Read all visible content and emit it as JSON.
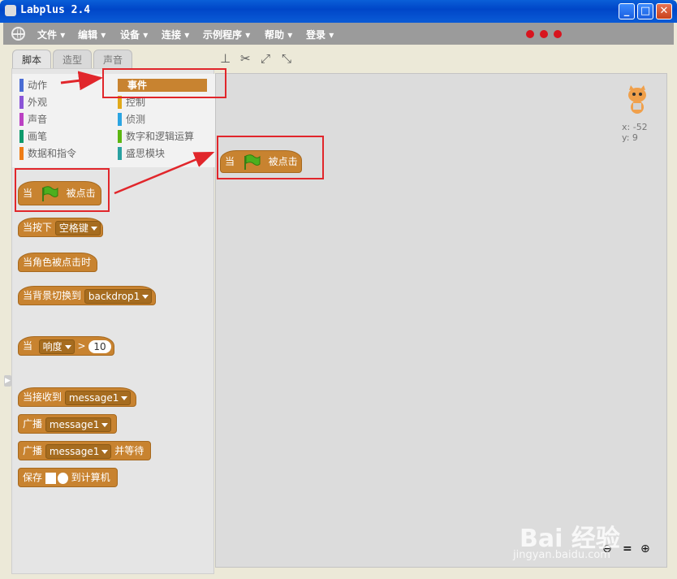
{
  "window": {
    "title": "Labplus 2.4",
    "controls": {
      "minimize": "_",
      "maximize": "□",
      "close": "✕"
    }
  },
  "menubar": {
    "items": [
      "文件",
      "编辑",
      "设备",
      "连接",
      "示例程序",
      "帮助",
      "登录"
    ],
    "status_dots_color": "#d8141e"
  },
  "tabs": [
    "脚本",
    "造型",
    "声音"
  ],
  "tools": [
    "stamp-icon",
    "cut-icon",
    "grow-icon",
    "shrink-icon"
  ],
  "categories": {
    "left": [
      {
        "label": "动作",
        "color": "#4a6cd4"
      },
      {
        "label": "外观",
        "color": "#8a55d7"
      },
      {
        "label": "声音",
        "color": "#bb42c3"
      },
      {
        "label": "画笔",
        "color": "#0e9a6c"
      },
      {
        "label": "数据和指令",
        "color": "#ee7d16"
      }
    ],
    "right": [
      {
        "label": "事件",
        "color": "#c88330"
      },
      {
        "label": "控制",
        "color": "#e1a91a"
      },
      {
        "label": "侦测",
        "color": "#2ca5e2"
      },
      {
        "label": "数字和逻辑运算",
        "color": "#5cb712"
      },
      {
        "label": "盛思模块",
        "color": "#2aa1a1"
      }
    ],
    "selected": "事件"
  },
  "palette_blocks": {
    "when_flag": {
      "prefix": "当",
      "suffix": "被点击"
    },
    "when_key": {
      "prefix": "当按下",
      "option": "空格键"
    },
    "when_sprite_clicked": {
      "label": "当角色被点击时"
    },
    "when_backdrop": {
      "prefix": "当背景切换到",
      "option": "backdrop1"
    },
    "when_sensor": {
      "prefix": "当",
      "option": "响度",
      "operator": ">",
      "value": "10"
    },
    "when_receive": {
      "prefix": "当接收到",
      "option": "message1"
    },
    "broadcast": {
      "prefix": "广播",
      "option": "message1"
    },
    "broadcast_wait": {
      "prefix": "广播",
      "option": "message1",
      "suffix": "并等待"
    },
    "save": {
      "prefix": "保存",
      "suffix": "到计算机"
    }
  },
  "script_blocks": {
    "when_flag": {
      "prefix": "当",
      "suffix": "被点击"
    }
  },
  "sprite_coords": {
    "x_label": "x:",
    "x": "-52",
    "y_label": "y:",
    "y": "9"
  },
  "zoom": {
    "out": "🔍-",
    "reset": "=",
    "in": "🔍+"
  },
  "watermark": {
    "brand": "Bai 经验",
    "url": "jingyan.baidu.com"
  }
}
